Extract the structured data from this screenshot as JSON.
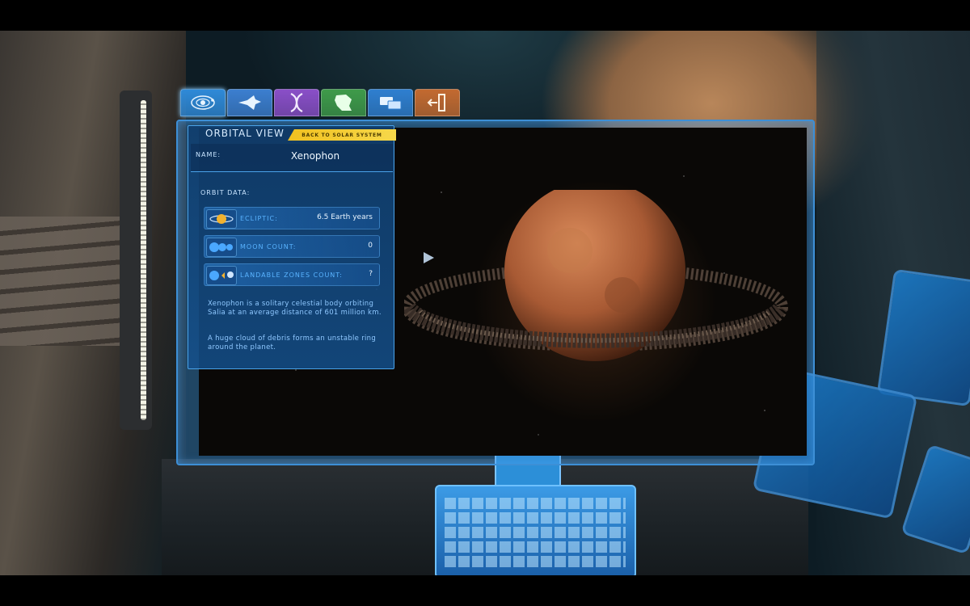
{
  "tabs": [
    {
      "id": "orbital",
      "icon": "solar-orbit-icon",
      "color": "#2f8ad8",
      "active": true
    },
    {
      "id": "ship",
      "icon": "spaceship-icon",
      "color": "#3c7fd0",
      "active": false
    },
    {
      "id": "dna",
      "icon": "dna-icon",
      "color": "#8a4fc8",
      "active": false
    },
    {
      "id": "map",
      "icon": "map-icon",
      "color": "#3f9b4a",
      "active": false
    },
    {
      "id": "cards",
      "icon": "cards-icon",
      "color": "#2f7fd0",
      "active": false
    },
    {
      "id": "exit",
      "icon": "exit-door-icon",
      "color": "#c36a30",
      "active": false
    }
  ],
  "panel": {
    "title": "ORBITAL VIEW",
    "back_button": "BACK TO SOLAR SYSTEM",
    "name_label": "NAME:",
    "name_value": "Xenophon",
    "orbit_label": "ORBIT DATA:",
    "rows": [
      {
        "label": "ECLIPTIC:",
        "value": "6.5 Earth years",
        "icon": "ecliptic-icon"
      },
      {
        "label": "MOON COUNT:",
        "value": "0",
        "icon": "moon-count-icon"
      },
      {
        "label": "LANDABLE ZONES COUNT:",
        "value": "?",
        "icon": "landable-zones-icon"
      }
    ],
    "description": [
      "Xenophon is a solitary celestial body orbiting Salia at an average distance of 601 million km.",
      "A huge cloud of debris forms an unstable ring around the planet."
    ]
  },
  "colors": {
    "holo_blue": "#3d8fd6",
    "label_blue": "#59b3ff",
    "back_button_yellow": "#f0c020",
    "planet": "#b5643a"
  }
}
